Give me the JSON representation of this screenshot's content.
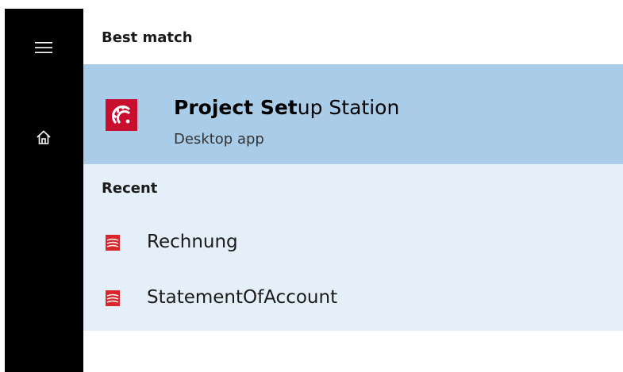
{
  "sidebar": {
    "menu_icon": "hamburger-icon",
    "home_icon": "home-icon",
    "background": "#000000"
  },
  "best_match": {
    "header": "Best match",
    "item": {
      "name_bold": "Project Set",
      "name_rest": "up Station",
      "type": "Desktop app",
      "icon": "gear-app-icon",
      "highlight": "#a9cde8",
      "tile_color": "#c8102e"
    }
  },
  "recent": {
    "header": "Recent",
    "background": "#e4eff9",
    "items": [
      {
        "label": "Rechnung",
        "icon": "document-icon"
      },
      {
        "label": "StatementOfAccount",
        "icon": "document-icon"
      }
    ]
  }
}
